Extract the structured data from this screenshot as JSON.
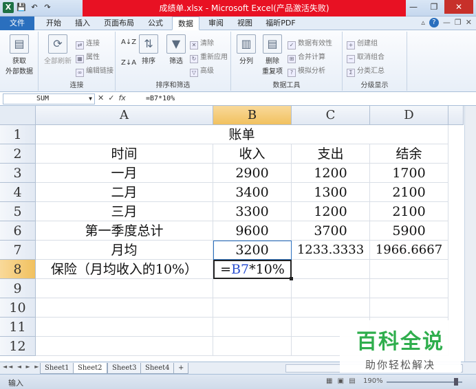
{
  "window": {
    "title": "成绩单.xlsx - Microsoft Excel(产品激活失败)",
    "controls": {
      "minimize": "—",
      "restore": "❐",
      "close": "✕"
    }
  },
  "quick_access": {
    "app_icon": "X",
    "save": "💾",
    "undo": "↶",
    "redo": "↷"
  },
  "ribbon_tabs": [
    "文件",
    "开始",
    "插入",
    "页面布局",
    "公式",
    "数据",
    "审阅",
    "视图",
    "福昕PDF"
  ],
  "active_tab": "数据",
  "ribbon": {
    "get_external": {
      "label": "获取\n外部数据",
      "line1": "获取",
      "line2": "外部数据"
    },
    "connections": {
      "group_label": "连接",
      "refresh_all": "全部刷新",
      "connect": "连接",
      "properties": "属性",
      "edit_links": "编辑链接"
    },
    "sort_filter": {
      "group_label": "排序和筛选",
      "sort": "排序",
      "filter": "筛选",
      "clear": "清除",
      "reapply": "重新应用",
      "advanced": "高级",
      "az": "A↓Z",
      "za": "Z↓A"
    },
    "data_tools": {
      "group_label": "数据工具",
      "text_to_columns": "分列",
      "remove_duplicates": "删除\n重复项",
      "remove_line1": "删除",
      "remove_line2": "重复项",
      "data_validation": "数据有效性",
      "consolidate": "合并计算",
      "what_if": "模拟分析"
    },
    "outline": {
      "group_label": "分级显示",
      "group": "创建组",
      "ungroup": "取消组合",
      "subtotal": "分类汇总"
    }
  },
  "formula_bar": {
    "name_box": "SUM",
    "cancel": "✕",
    "enter": "✓",
    "fx": "fx",
    "formula": "=B7*10%"
  },
  "columns": [
    "A",
    "B",
    "C",
    "D"
  ],
  "rows": [
    "1",
    "2",
    "3",
    "4",
    "5",
    "6",
    "7",
    "8",
    "9",
    "10",
    "11",
    "12"
  ],
  "sheet": {
    "title": "账单",
    "header": [
      "时间",
      "收入",
      "支出",
      "结余"
    ],
    "data": [
      [
        "一月",
        "2900",
        "1200",
        "1700"
      ],
      [
        "二月",
        "3400",
        "1300",
        "2100"
      ],
      [
        "三月",
        "3300",
        "1200",
        "2100"
      ],
      [
        "第一季度总计",
        "9600",
        "3700",
        "5900"
      ],
      [
        "月均",
        "3200",
        "1233.3333",
        "1966.6667"
      ]
    ],
    "row8_label": "保险（月均收入的10%）",
    "row8_formula_prefix": "=",
    "row8_formula_ref": "B7",
    "row8_formula_suffix": "*10%"
  },
  "sheet_tabs": [
    "Sheet1",
    "Sheet2",
    "Sheet3",
    "Sheet4"
  ],
  "active_sheet": "Sheet2",
  "sheet_nav": "◄◄ ◄ ► ►►",
  "status": {
    "mode": "输入",
    "zoom": "190%",
    "views": "▦ ▣ ▤"
  },
  "watermark": {
    "brand": "百科全说",
    "tagline": "助你轻松解决"
  }
}
